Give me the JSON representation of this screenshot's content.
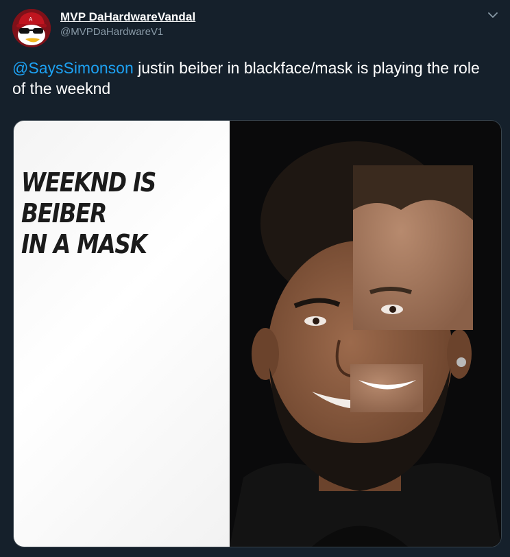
{
  "tweet": {
    "display_name": "MVP DaHardwareVandal",
    "handle": "@MVPDaHardwareV1",
    "mention": "@SaysSimonson",
    "text": " justin beiber in blackface/mask is playing the role of the weeknd"
  },
  "media": {
    "meme_text": "WEEKND IS BEIBER\nIN A MASK",
    "photo_subject": "portrait-photo"
  },
  "icons": {
    "caret": "chevron-down-icon",
    "avatar": "penguin-avatar"
  },
  "colors": {
    "background": "#15202b",
    "text": "#ffffff",
    "secondary_text": "#8899a6",
    "link": "#1da1f2",
    "border": "#38444d"
  }
}
